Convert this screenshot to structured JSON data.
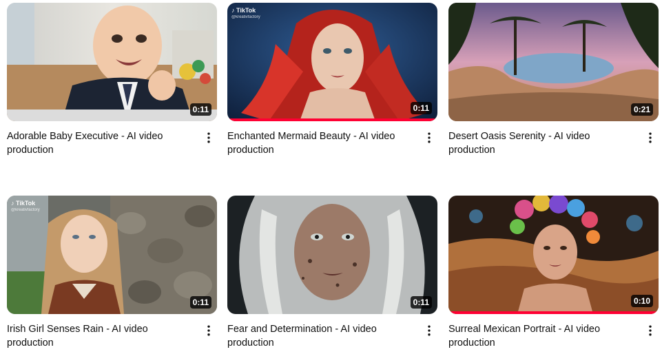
{
  "videos": [
    {
      "title": "Adorable Baby Executive - AI video production",
      "duration": "0:11",
      "tiktok_label": "",
      "tiktok_handle": "",
      "watched_fraction": 0
    },
    {
      "title": "Enchanted Mermaid Beauty - AI video production",
      "duration": "0:11",
      "tiktok_label": "TikTok",
      "tiktok_handle": "@kreativfactory",
      "watched_fraction": 1.0
    },
    {
      "title": "Desert Oasis Serenity - AI video production",
      "duration": "0:21",
      "tiktok_label": "",
      "tiktok_handle": "",
      "watched_fraction": 0
    },
    {
      "title": "Irish Girl Senses Rain - AI video production",
      "duration": "0:11",
      "tiktok_label": "TikTok",
      "tiktok_handle": "@kreativfactory",
      "watched_fraction": 0
    },
    {
      "title": "Fear and Determination - AI video production",
      "duration": "0:11",
      "tiktok_label": "",
      "tiktok_handle": "",
      "watched_fraction": 0
    },
    {
      "title": "Surreal Mexican Portrait - AI video production",
      "duration": "0:10",
      "tiktok_label": "",
      "tiktok_handle": "",
      "watched_fraction": 1.0
    }
  ],
  "icons": {
    "menu": "more-vert-icon",
    "tiktok": "tiktok-icon"
  },
  "colors": {
    "progress": "#ff0033",
    "title_text": "#0f0f0f"
  }
}
